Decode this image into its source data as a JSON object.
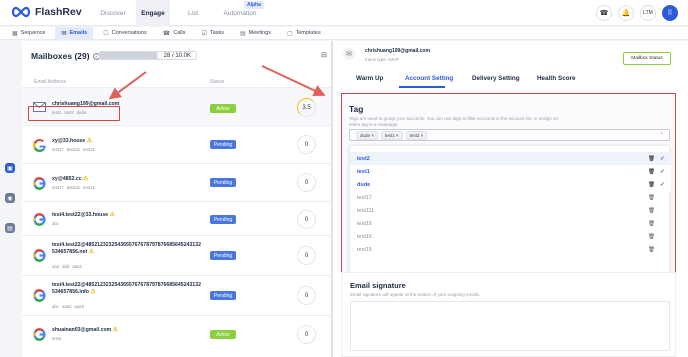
{
  "app": {
    "name": "FlashRev"
  },
  "topnav": {
    "tabs": [
      {
        "label": "Discover"
      },
      {
        "label": "Engage"
      },
      {
        "label": "List"
      },
      {
        "label": "Automation"
      }
    ],
    "alpha_badge": "Alpha",
    "avatar": "LTM"
  },
  "subnav": {
    "items": [
      {
        "label": "Sequence"
      },
      {
        "label": "Emails"
      },
      {
        "label": "Conversations"
      },
      {
        "label": "Calls"
      },
      {
        "label": "Tasks"
      },
      {
        "label": "Meetings"
      },
      {
        "label": "Templates"
      }
    ]
  },
  "mailboxes": {
    "title": "Mailboxes (29)",
    "quota": "28 / 10.0K",
    "columns": {
      "email": "Email Address",
      "status": "Status"
    },
    "rows": [
      {
        "email": "chrishuang199@gmail.com",
        "tags": [
          "test1",
          "test2",
          "dude"
        ],
        "status": "Active",
        "score": "3.5",
        "provider": "imap"
      },
      {
        "email": "xy@33.house",
        "warn": "⚠",
        "tags": [
          "test17",
          "test111",
          "test16"
        ],
        "status": "Pending",
        "score": "0",
        "provider": "google"
      },
      {
        "email": "xy@4852.cc",
        "warn": "⚠",
        "tags": [
          "test17",
          "test111",
          "test16"
        ],
        "status": "Pending",
        "score": "0",
        "provider": "google"
      },
      {
        "email": "test4.test22@33.house",
        "warn": "⚠",
        "tags": [
          "abc"
        ],
        "status": "Pending",
        "score": "0",
        "provider": "google"
      },
      {
        "email": "test4.test22@4852123232543655767678797876685645243132534657856.net",
        "warn": "⚠",
        "tags": [
          "aaa",
          "ddd",
          "aaa2"
        ],
        "status": "Pending",
        "score": "0",
        "provider": "google"
      },
      {
        "email": "test4.test22@4852123232543655767678797876685645243132534657856.info",
        "warn": "⚠",
        "tags": [
          "abc",
          "aaa2",
          "aaa3"
        ],
        "status": "Pending",
        "score": "0",
        "provider": "google"
      },
      {
        "email": "shuainan03@gmail.com",
        "warn": "⚠",
        "tags": [
          "test1"
        ],
        "status": "Active",
        "score": "0",
        "provider": "google"
      }
    ]
  },
  "detail": {
    "email": "chrishuang199@gmail.com",
    "inbox_type": "Inbox type: IMAP",
    "mailbox_status": "Mailbox Status",
    "tabs": [
      {
        "label": "Warm Up"
      },
      {
        "label": "Account Setting"
      },
      {
        "label": "Delivery Setting"
      },
      {
        "label": "Health Score"
      }
    ],
    "tag": {
      "title": "Tag",
      "desc": "Tags are used to group your accounts. You can use tags to filter accounts in the account list, or assign an entire tag to a campaign.",
      "selected": [
        "dude",
        "test1",
        "test2"
      ],
      "options": [
        {
          "label": "test2",
          "selected": true
        },
        {
          "label": "test1",
          "selected": true
        },
        {
          "label": "dude",
          "selected": true
        },
        {
          "label": "test17",
          "selected": false
        },
        {
          "label": "test111",
          "selected": false
        },
        {
          "label": "test16",
          "selected": false
        },
        {
          "label": "test16",
          "selected": false
        },
        {
          "label": "test15",
          "selected": false
        }
      ]
    },
    "signature": {
      "title": "Email signature",
      "desc": "Email signature will appear at the bottom of your outgoing emails."
    }
  },
  "colors": {
    "brand": "#2b5bd7",
    "active": "#8ccf3e",
    "pending": "#4a76e0",
    "highlight": "#d64545"
  },
  "icons": [
    "phone-icon",
    "bell-icon",
    "grid-icon",
    "trash-icon",
    "check-icon",
    "info-icon",
    "google-icon",
    "mail-icon",
    "warning-icon"
  ]
}
